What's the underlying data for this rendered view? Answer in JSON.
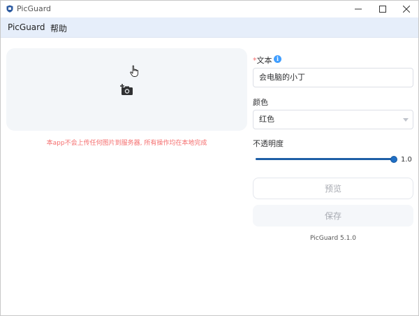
{
  "window": {
    "title": "PicGuard"
  },
  "menu": {
    "items": [
      "PicGuard",
      "帮助"
    ]
  },
  "upload": {
    "notice": "本app不会上传任何图片到服务器, 所有操作均在本地完成",
    "icons": [
      "cursor-hand-icon",
      "add-photo-icon"
    ]
  },
  "form": {
    "text_label_required": "*",
    "text_label": "文本",
    "text_value": "会电脑的小丁",
    "color_label": "颜色",
    "color_value": "红色",
    "opacity_label": "不透明度",
    "opacity_value": "1.0",
    "opacity_level": 1.0
  },
  "buttons": {
    "preview": "预览",
    "save": "保存"
  },
  "footer": {
    "version": "PicGuard 5.1.0"
  },
  "colors": {
    "menubar": "#e6eefa",
    "accent": "#409eff",
    "notice": "#f56c6c",
    "required": "#f56c6c"
  }
}
